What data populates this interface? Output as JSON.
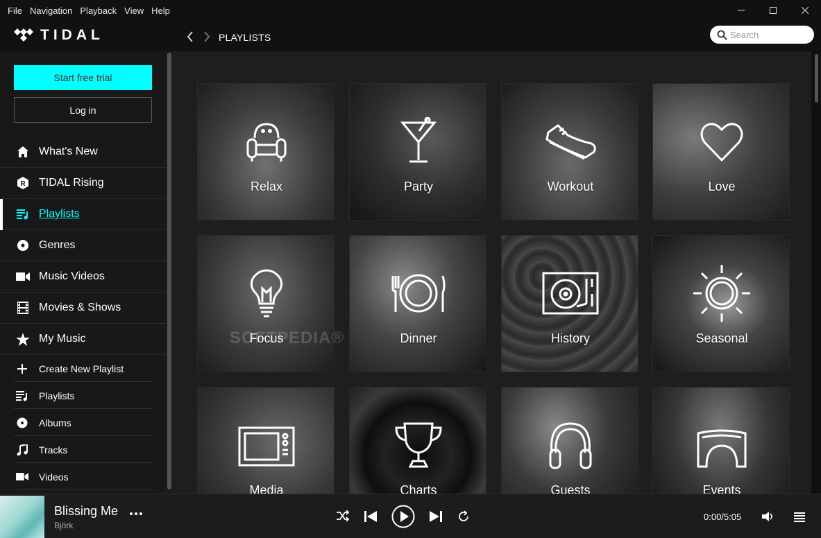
{
  "menu": [
    "File",
    "Navigation",
    "Playback",
    "View",
    "Help"
  ],
  "header": {
    "logo_text": "TIDAL",
    "page_title": "PLAYLISTS",
    "search_placeholder": "Search"
  },
  "sidebar": {
    "trial_label": "Start free trial",
    "login_label": "Log in",
    "nav": [
      {
        "label": "What's New",
        "icon": "home-icon"
      },
      {
        "label": "TIDAL Rising",
        "icon": "rising-icon"
      },
      {
        "label": "Playlists",
        "icon": "playlist-icon",
        "active": true
      },
      {
        "label": "Genres",
        "icon": "genres-icon"
      },
      {
        "label": "Music Videos",
        "icon": "video-camera-icon"
      },
      {
        "label": "Movies & Shows",
        "icon": "film-icon"
      },
      {
        "label": "My Music",
        "icon": "star-icon"
      }
    ],
    "sub": [
      {
        "label": "Create New Playlist",
        "icon": "plus-icon"
      },
      {
        "label": "Playlists",
        "icon": "playlist-icon"
      },
      {
        "label": "Albums",
        "icon": "album-icon"
      },
      {
        "label": "Tracks",
        "icon": "music-note-icon"
      },
      {
        "label": "Videos",
        "icon": "video-camera-icon"
      }
    ]
  },
  "tiles": [
    {
      "label": "Relax",
      "icon": "armchair-icon"
    },
    {
      "label": "Party",
      "icon": "cocktail-icon"
    },
    {
      "label": "Workout",
      "icon": "sneaker-icon"
    },
    {
      "label": "Love",
      "icon": "heart-icon"
    },
    {
      "label": "Focus",
      "icon": "lightbulb-icon"
    },
    {
      "label": "Dinner",
      "icon": "plate-cutlery-icon"
    },
    {
      "label": "History",
      "icon": "turntable-icon"
    },
    {
      "label": "Seasonal",
      "icon": "sun-icon"
    },
    {
      "label": "Media",
      "icon": "tv-icon"
    },
    {
      "label": "Charts",
      "icon": "trophy-icon"
    },
    {
      "label": "Guests",
      "icon": "headphones-icon"
    },
    {
      "label": "Events",
      "icon": "stage-icon"
    }
  ],
  "watermark": "SOFTPEDIA®",
  "player": {
    "title": "Blissing Me",
    "artist": "Björk",
    "time": "0:00/5:05"
  },
  "colors": {
    "accent": "#00ffff",
    "background": "#101010",
    "sidebar": "#181818"
  }
}
